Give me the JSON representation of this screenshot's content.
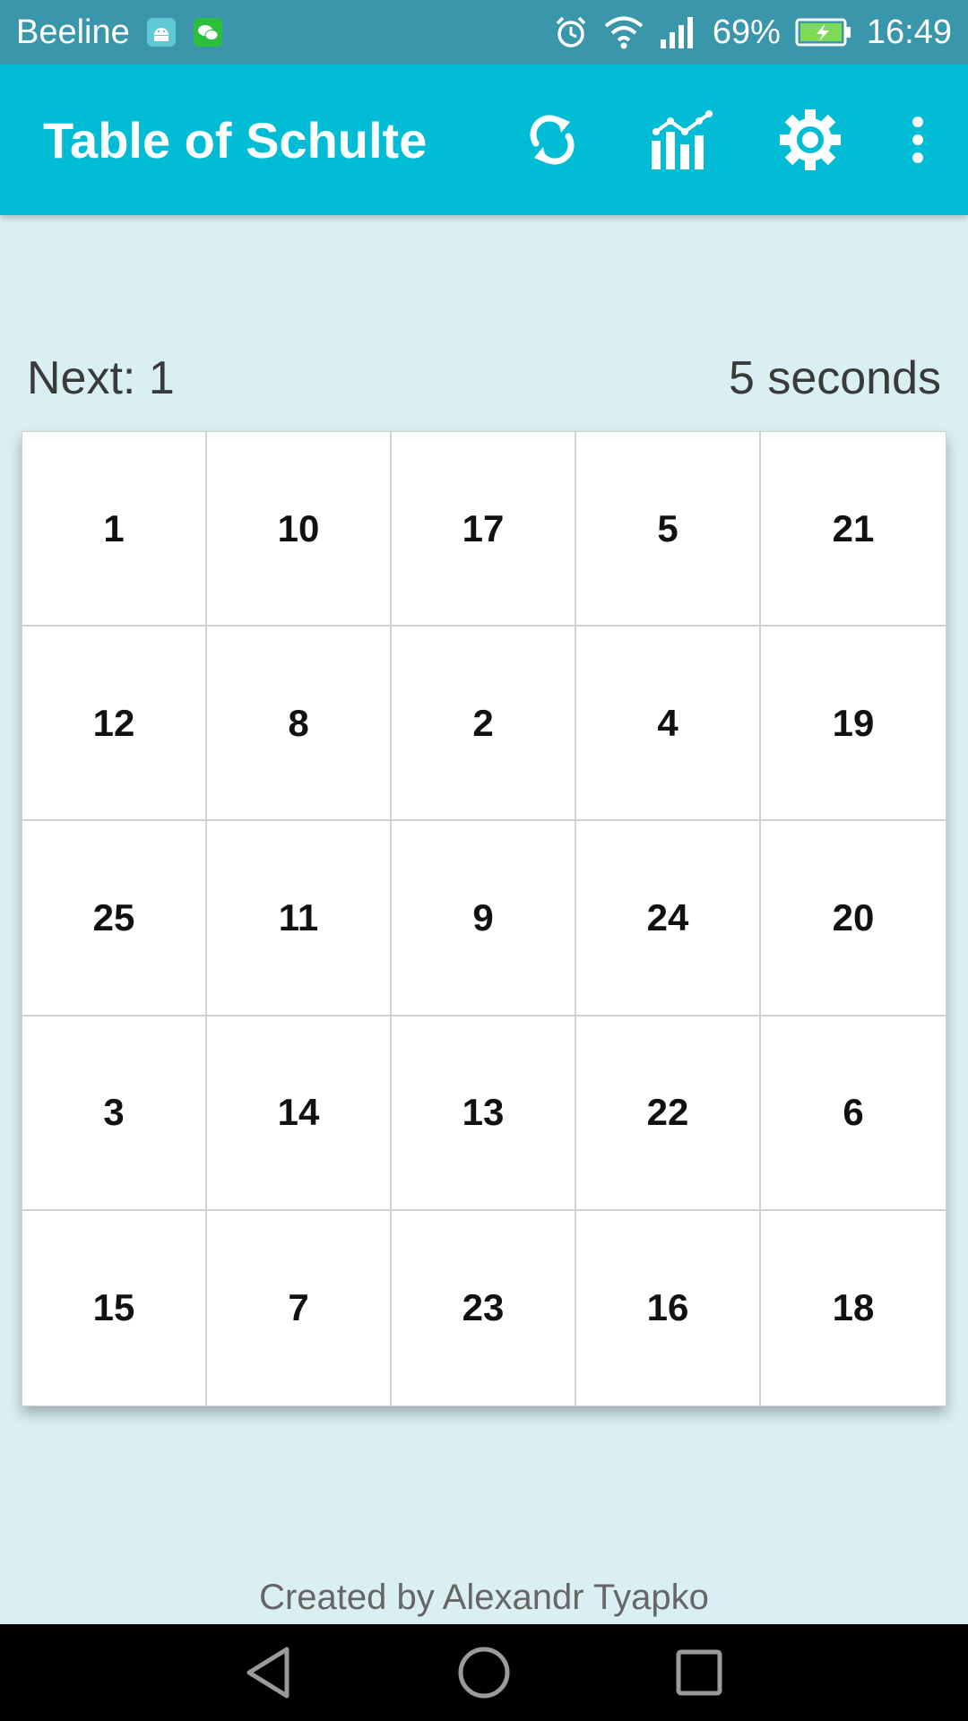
{
  "status_bar": {
    "carrier": "Beeline",
    "battery_percent": "69%",
    "time": "16:49",
    "icons": [
      "android-icon",
      "wechat-icon",
      "alarm-icon",
      "wifi-icon",
      "signal-icon",
      "battery-charging-icon"
    ]
  },
  "app_bar": {
    "title": "Table of Schulte",
    "actions": [
      "refresh-icon",
      "stats-chart-icon",
      "settings-gear-icon",
      "more-vert-icon"
    ],
    "background": "#00bcd4"
  },
  "game": {
    "next_label": "Next: 1",
    "timer_label": "5 seconds",
    "cells": [
      "1",
      "10",
      "17",
      "5",
      "21",
      "12",
      "8",
      "2",
      "4",
      "19",
      "25",
      "11",
      "9",
      "24",
      "20",
      "3",
      "14",
      "13",
      "22",
      "6",
      "15",
      "7",
      "23",
      "16",
      "18"
    ]
  },
  "footer": {
    "credit": "Created by Alexandr Tyapko"
  },
  "nav_bar": {
    "buttons": [
      "back-icon",
      "home-icon",
      "recents-icon"
    ]
  }
}
